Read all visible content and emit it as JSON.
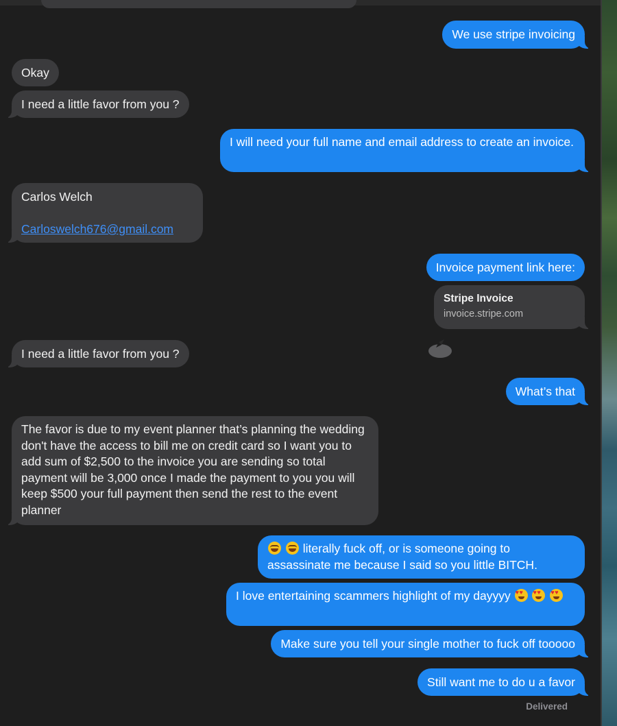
{
  "messages": [
    {
      "text": "We use stripe invoicing"
    },
    {
      "text": "Okay"
    },
    {
      "text": "I need a little favor from you ?"
    },
    {
      "text": "I will need your full name and email address to create an invoice."
    },
    {
      "name_line": "Carlos Welch",
      "email": "Carloswelch676@gmail.com"
    },
    {
      "text": "Invoice payment link here:"
    },
    {
      "link_title": "Stripe Invoice",
      "link_domain": "invoice.stripe.com"
    },
    {
      "text": "I need a little favor from you ?"
    },
    {
      "text": "What’s that"
    },
    {
      "text": "The favor is due to my event planner that’s planning the wedding don't have the access to bill me on credit card so I want you to add sum of $2,500 to the invoice you are sending so total payment will be 3,000 once I made the payment to you you will keep $500 your full payment then send the rest to the event planner"
    },
    {
      "text": "literally fuck off, or is someone going to assassinate me because I said so you little BITCH."
    },
    {
      "text": "I love entertaining scammers highlight of my dayyyy"
    },
    {
      "text": "Make sure you tell your single mother to fuck off tooooo"
    },
    {
      "text": "Still want me to do u a favor"
    }
  ],
  "status": {
    "delivered": "Delivered"
  },
  "colors": {
    "outgoing": "#1e86f0",
    "incoming": "#3b3b3d",
    "background": "#1e1e1e",
    "link": "#3f8ff7"
  }
}
